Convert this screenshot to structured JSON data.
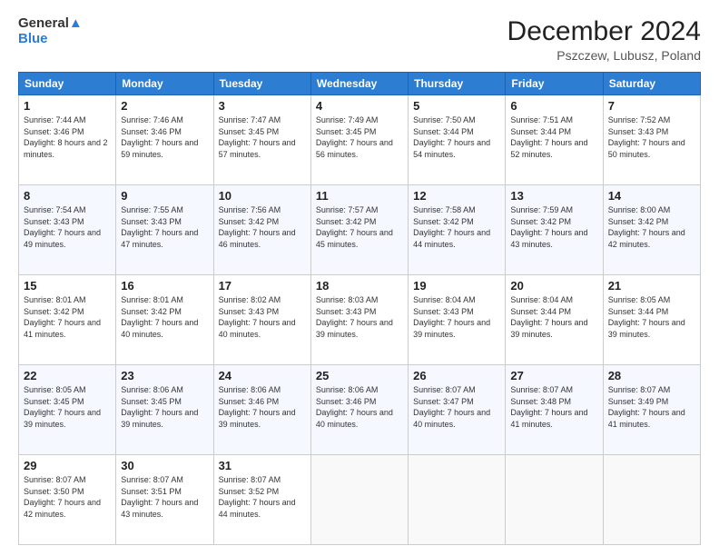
{
  "logo": {
    "line1": "General",
    "line2": "Blue"
  },
  "title": "December 2024",
  "subtitle": "Pszczew, Lubusz, Poland",
  "days_header": [
    "Sunday",
    "Monday",
    "Tuesday",
    "Wednesday",
    "Thursday",
    "Friday",
    "Saturday"
  ],
  "weeks": [
    [
      {
        "day": "1",
        "sunrise": "Sunrise: 7:44 AM",
        "sunset": "Sunset: 3:46 PM",
        "daylight": "Daylight: 8 hours and 2 minutes."
      },
      {
        "day": "2",
        "sunrise": "Sunrise: 7:46 AM",
        "sunset": "Sunset: 3:46 PM",
        "daylight": "Daylight: 7 hours and 59 minutes."
      },
      {
        "day": "3",
        "sunrise": "Sunrise: 7:47 AM",
        "sunset": "Sunset: 3:45 PM",
        "daylight": "Daylight: 7 hours and 57 minutes."
      },
      {
        "day": "4",
        "sunrise": "Sunrise: 7:49 AM",
        "sunset": "Sunset: 3:45 PM",
        "daylight": "Daylight: 7 hours and 56 minutes."
      },
      {
        "day": "5",
        "sunrise": "Sunrise: 7:50 AM",
        "sunset": "Sunset: 3:44 PM",
        "daylight": "Daylight: 7 hours and 54 minutes."
      },
      {
        "day": "6",
        "sunrise": "Sunrise: 7:51 AM",
        "sunset": "Sunset: 3:44 PM",
        "daylight": "Daylight: 7 hours and 52 minutes."
      },
      {
        "day": "7",
        "sunrise": "Sunrise: 7:52 AM",
        "sunset": "Sunset: 3:43 PM",
        "daylight": "Daylight: 7 hours and 50 minutes."
      }
    ],
    [
      {
        "day": "8",
        "sunrise": "Sunrise: 7:54 AM",
        "sunset": "Sunset: 3:43 PM",
        "daylight": "Daylight: 7 hours and 49 minutes."
      },
      {
        "day": "9",
        "sunrise": "Sunrise: 7:55 AM",
        "sunset": "Sunset: 3:43 PM",
        "daylight": "Daylight: 7 hours and 47 minutes."
      },
      {
        "day": "10",
        "sunrise": "Sunrise: 7:56 AM",
        "sunset": "Sunset: 3:42 PM",
        "daylight": "Daylight: 7 hours and 46 minutes."
      },
      {
        "day": "11",
        "sunrise": "Sunrise: 7:57 AM",
        "sunset": "Sunset: 3:42 PM",
        "daylight": "Daylight: 7 hours and 45 minutes."
      },
      {
        "day": "12",
        "sunrise": "Sunrise: 7:58 AM",
        "sunset": "Sunset: 3:42 PM",
        "daylight": "Daylight: 7 hours and 44 minutes."
      },
      {
        "day": "13",
        "sunrise": "Sunrise: 7:59 AM",
        "sunset": "Sunset: 3:42 PM",
        "daylight": "Daylight: 7 hours and 43 minutes."
      },
      {
        "day": "14",
        "sunrise": "Sunrise: 8:00 AM",
        "sunset": "Sunset: 3:42 PM",
        "daylight": "Daylight: 7 hours and 42 minutes."
      }
    ],
    [
      {
        "day": "15",
        "sunrise": "Sunrise: 8:01 AM",
        "sunset": "Sunset: 3:42 PM",
        "daylight": "Daylight: 7 hours and 41 minutes."
      },
      {
        "day": "16",
        "sunrise": "Sunrise: 8:01 AM",
        "sunset": "Sunset: 3:42 PM",
        "daylight": "Daylight: 7 hours and 40 minutes."
      },
      {
        "day": "17",
        "sunrise": "Sunrise: 8:02 AM",
        "sunset": "Sunset: 3:43 PM",
        "daylight": "Daylight: 7 hours and 40 minutes."
      },
      {
        "day": "18",
        "sunrise": "Sunrise: 8:03 AM",
        "sunset": "Sunset: 3:43 PM",
        "daylight": "Daylight: 7 hours and 39 minutes."
      },
      {
        "day": "19",
        "sunrise": "Sunrise: 8:04 AM",
        "sunset": "Sunset: 3:43 PM",
        "daylight": "Daylight: 7 hours and 39 minutes."
      },
      {
        "day": "20",
        "sunrise": "Sunrise: 8:04 AM",
        "sunset": "Sunset: 3:44 PM",
        "daylight": "Daylight: 7 hours and 39 minutes."
      },
      {
        "day": "21",
        "sunrise": "Sunrise: 8:05 AM",
        "sunset": "Sunset: 3:44 PM",
        "daylight": "Daylight: 7 hours and 39 minutes."
      }
    ],
    [
      {
        "day": "22",
        "sunrise": "Sunrise: 8:05 AM",
        "sunset": "Sunset: 3:45 PM",
        "daylight": "Daylight: 7 hours and 39 minutes."
      },
      {
        "day": "23",
        "sunrise": "Sunrise: 8:06 AM",
        "sunset": "Sunset: 3:45 PM",
        "daylight": "Daylight: 7 hours and 39 minutes."
      },
      {
        "day": "24",
        "sunrise": "Sunrise: 8:06 AM",
        "sunset": "Sunset: 3:46 PM",
        "daylight": "Daylight: 7 hours and 39 minutes."
      },
      {
        "day": "25",
        "sunrise": "Sunrise: 8:06 AM",
        "sunset": "Sunset: 3:46 PM",
        "daylight": "Daylight: 7 hours and 40 minutes."
      },
      {
        "day": "26",
        "sunrise": "Sunrise: 8:07 AM",
        "sunset": "Sunset: 3:47 PM",
        "daylight": "Daylight: 7 hours and 40 minutes."
      },
      {
        "day": "27",
        "sunrise": "Sunrise: 8:07 AM",
        "sunset": "Sunset: 3:48 PM",
        "daylight": "Daylight: 7 hours and 41 minutes."
      },
      {
        "day": "28",
        "sunrise": "Sunrise: 8:07 AM",
        "sunset": "Sunset: 3:49 PM",
        "daylight": "Daylight: 7 hours and 41 minutes."
      }
    ],
    [
      {
        "day": "29",
        "sunrise": "Sunrise: 8:07 AM",
        "sunset": "Sunset: 3:50 PM",
        "daylight": "Daylight: 7 hours and 42 minutes."
      },
      {
        "day": "30",
        "sunrise": "Sunrise: 8:07 AM",
        "sunset": "Sunset: 3:51 PM",
        "daylight": "Daylight: 7 hours and 43 minutes."
      },
      {
        "day": "31",
        "sunrise": "Sunrise: 8:07 AM",
        "sunset": "Sunset: 3:52 PM",
        "daylight": "Daylight: 7 hours and 44 minutes."
      },
      null,
      null,
      null,
      null
    ]
  ]
}
